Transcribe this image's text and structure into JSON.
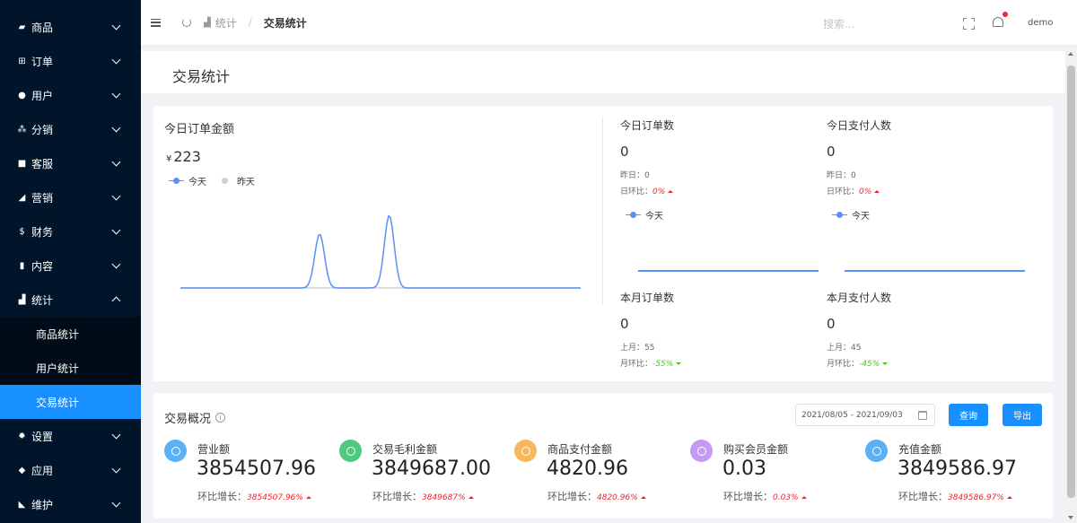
{
  "sidebar": {
    "items": [
      {
        "label": "商品",
        "icon": "bag-icon"
      },
      {
        "label": "订单",
        "icon": "cart-icon"
      },
      {
        "label": "用户",
        "icon": "user-icon"
      },
      {
        "label": "分销",
        "icon": "group-icon"
      },
      {
        "label": "客服",
        "icon": "chat-icon"
      },
      {
        "label": "营销",
        "icon": "send-icon"
      },
      {
        "label": "财务",
        "icon": "dollar-icon"
      },
      {
        "label": "内容",
        "icon": "book-icon"
      },
      {
        "label": "统计",
        "icon": "bar-chart-icon"
      },
      {
        "label": "设置",
        "icon": "gear-icon"
      },
      {
        "label": "应用",
        "icon": "cube-icon"
      },
      {
        "label": "维护",
        "icon": "wrench-icon"
      }
    ],
    "submenu": [
      {
        "label": "商品统计"
      },
      {
        "label": "用户统计"
      },
      {
        "label": "交易统计"
      }
    ]
  },
  "header": {
    "breadcrumb_parent": "统计",
    "breadcrumb_sep": "/",
    "breadcrumb_current": "交易统计",
    "search_placeholder": "搜索...",
    "user": "demo"
  },
  "page_title": "交易统计",
  "today": {
    "title": "今日订单金额",
    "currency": "¥",
    "amount": "223",
    "legend_today": "今天",
    "legend_yesterday": "昨天",
    "chart_data": {
      "type": "line",
      "series": [
        {
          "name": "今天",
          "values": [
            0,
            0,
            0,
            0,
            0,
            0,
            0,
            0,
            95,
            0,
            0,
            0,
            128,
            0,
            0,
            0,
            0,
            0,
            0,
            0,
            0,
            0,
            0,
            0
          ]
        },
        {
          "name": "昨天",
          "values": [
            0,
            0,
            0,
            0,
            0,
            0,
            0,
            0,
            0,
            0,
            0,
            0,
            0,
            0,
            0,
            0,
            0,
            0,
            0,
            0,
            0,
            0,
            0,
            0
          ]
        }
      ]
    },
    "stats": [
      {
        "title": "今日订单数",
        "value": "0",
        "prev_label": "昨日：",
        "prev_value": "0",
        "ratio_label": "日环比：",
        "ratio": "0%",
        "trend": "up",
        "legend": "今天"
      },
      {
        "title": "今日支付人数",
        "value": "0",
        "prev_label": "昨日：",
        "prev_value": "0",
        "ratio_label": "日环比：",
        "ratio": "0%",
        "trend": "up",
        "legend": "今天"
      },
      {
        "title": "本月订单数",
        "value": "0",
        "prev_label": "上月：",
        "prev_value": "55",
        "ratio_label": "月环比：",
        "ratio": "-55%",
        "trend": "down"
      },
      {
        "title": "本月支付人数",
        "value": "0",
        "prev_label": "上月：",
        "prev_value": "45",
        "ratio_label": "月环比：",
        "ratio": "-45%",
        "trend": "down"
      }
    ]
  },
  "overview": {
    "title": "交易概况",
    "date_range": "2021/08/05 - 2021/09/03",
    "query_label": "查询",
    "export_label": "导出",
    "items": [
      {
        "label": "营业额",
        "value": "3854507.96",
        "growth_label": "环比增长：",
        "growth": "3854507.96%",
        "color": "#5cb0f5",
        "icon": "pie-icon"
      },
      {
        "label": "交易毛利金额",
        "value": "3849687.00",
        "growth_label": "环比增长：",
        "growth": "3849687%",
        "color": "#4fc97e",
        "icon": "coin-icon"
      },
      {
        "label": "商品支付金额",
        "value": "4820.96",
        "growth_label": "环比增长：",
        "growth": "4820.96%",
        "color": "#f7b85b",
        "icon": "shopping-bag-icon"
      },
      {
        "label": "购买会员金额",
        "value": "0.03",
        "growth_label": "环比增长：",
        "growth": "0.03%",
        "color": "#c59af2",
        "icon": "diamond-icon"
      },
      {
        "label": "充值金额",
        "value": "3849586.97",
        "growth_label": "环比增长：",
        "growth": "3849586.97%",
        "color": "#5cb0f5",
        "icon": "gauge-icon"
      }
    ]
  }
}
